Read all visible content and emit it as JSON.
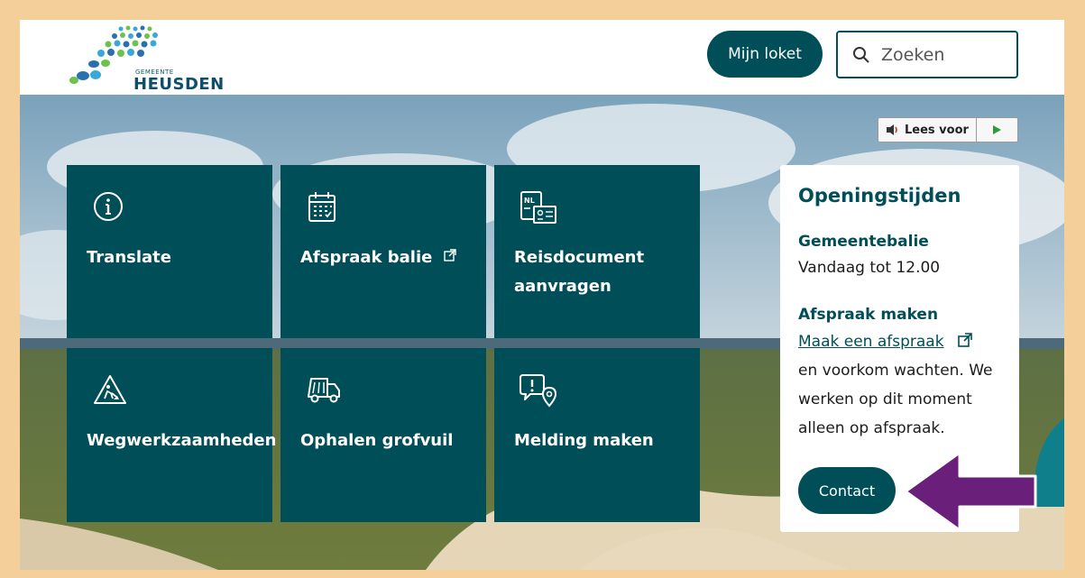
{
  "header": {
    "logo": {
      "small_text": "GEMEENTE",
      "big_text": "HEUSDEN"
    },
    "loket_button": "Mijn loket",
    "search": {
      "placeholder": "Zoeken",
      "icon": "search-icon"
    }
  },
  "read_aloud": {
    "label": "Lees voor",
    "speaker_icon": "speaker-icon",
    "play_icon": "play-icon"
  },
  "tiles": [
    {
      "label": "Translate",
      "icon": "info-icon"
    },
    {
      "label": "Afspraak balie",
      "icon": "calendar-icon",
      "external": true
    },
    {
      "label": "Reisdocument aanvragen",
      "icon": "passport-icon"
    },
    {
      "label": "Wegwerkzaamheden",
      "icon": "roadwork-icon"
    },
    {
      "label": "Ophalen grofvuil",
      "icon": "truck-icon"
    },
    {
      "label": "Melding maken",
      "icon": "report-location-icon"
    }
  ],
  "opening_hours": {
    "title": "Openingstijden",
    "desk_title": "Gemeentebalie",
    "desk_hours": "Vandaag tot 12.00",
    "appointment_title": "Afspraak maken",
    "appointment_link": "Maak een afspraak",
    "appointment_text_1": "en voorkom wachten. We",
    "appointment_text_2": "werken op dit moment",
    "appointment_text_3": "alleen op afspraak.",
    "contact_button": "Contact"
  },
  "colors": {
    "primary": "#004e57",
    "frame": "#f5cf9a",
    "arrow": "#6a1f7a"
  }
}
